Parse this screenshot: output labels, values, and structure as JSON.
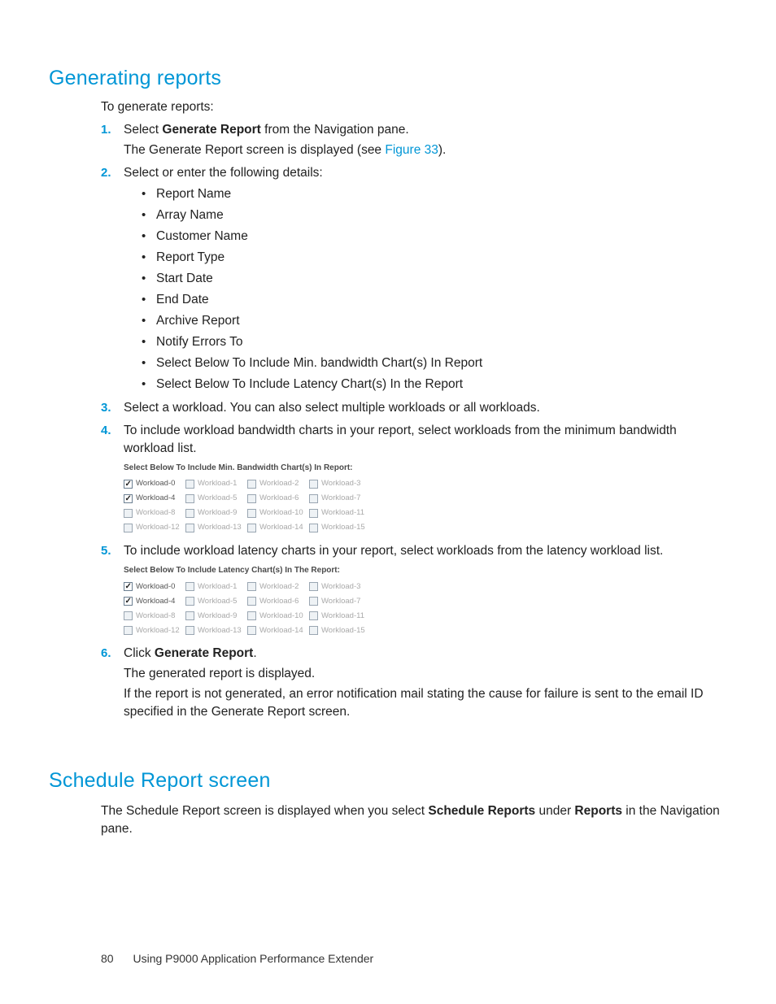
{
  "section1": {
    "title": "Generating reports",
    "intro": "To generate reports:",
    "steps": [
      {
        "num": "1.",
        "lines": [
          [
            {
              "t": "Select "
            },
            {
              "t": "Generate Report",
              "b": true
            },
            {
              "t": " from the Navigation pane."
            }
          ],
          [
            {
              "t": "The Generate Report screen is displayed (see "
            },
            {
              "t": "Figure 33",
              "link": true
            },
            {
              "t": ")."
            }
          ]
        ]
      },
      {
        "num": "2.",
        "lines": [
          [
            {
              "t": "Select or enter the following details:"
            }
          ]
        ],
        "bullets": [
          "Report Name",
          "Array Name",
          "Customer Name",
          "Report Type",
          "Start Date",
          "End Date",
          "Archive Report",
          "Notify Errors To",
          "Select Below To Include Min. bandwidth Chart(s) In Report",
          "Select Below To Include Latency Chart(s) In the Report"
        ]
      },
      {
        "num": "3.",
        "lines": [
          [
            {
              "t": "Select a workload. You can also select multiple workloads or all workloads."
            }
          ]
        ]
      },
      {
        "num": "4.",
        "lines": [
          [
            {
              "t": "To include workload bandwidth charts in your report, select workloads from the minimum bandwidth workload list."
            }
          ]
        ],
        "panel": "bw"
      },
      {
        "num": "5.",
        "lines": [
          [
            {
              "t": "To include workload latency charts in your report, select workloads from the latency workload list."
            }
          ]
        ],
        "panel": "lat"
      },
      {
        "num": "6.",
        "lines": [
          [
            {
              "t": "Click "
            },
            {
              "t": "Generate Report",
              "b": true
            },
            {
              "t": "."
            }
          ],
          [
            {
              "t": "The generated report is displayed."
            }
          ],
          [
            {
              "t": "If the report is not generated, an error notification mail stating the cause for failure is sent to the email ID specified in the Generate Report screen."
            }
          ]
        ]
      }
    ]
  },
  "panels": {
    "bw": {
      "title": "Select Below To Include Min. Bandwidth Chart(s) In Report:",
      "rows": [
        [
          {
            "label": "Workload-0",
            "checked": true,
            "active": true
          },
          {
            "label": "Workload-1"
          },
          {
            "label": "Workload-2"
          },
          {
            "label": "Workload-3"
          }
        ],
        [
          {
            "label": "Workload-4",
            "checked": true,
            "active": true
          },
          {
            "label": "Workload-5"
          },
          {
            "label": "Workload-6"
          },
          {
            "label": "Workload-7"
          }
        ],
        [
          {
            "label": "Workload-8"
          },
          {
            "label": "Workload-9"
          },
          {
            "label": "Workload-10"
          },
          {
            "label": "Workload-11"
          }
        ],
        [
          {
            "label": "Workload-12"
          },
          {
            "label": "Workload-13"
          },
          {
            "label": "Workload-14"
          },
          {
            "label": "Workload-15"
          }
        ]
      ]
    },
    "lat": {
      "title": "Select Below To Include Latency Chart(s) In The Report:",
      "rows": [
        [
          {
            "label": "Workload-0",
            "checked": true,
            "active": true
          },
          {
            "label": "Workload-1"
          },
          {
            "label": "Workload-2"
          },
          {
            "label": "Workload-3"
          }
        ],
        [
          {
            "label": "Workload-4",
            "checked": true,
            "active": true
          },
          {
            "label": "Workload-5"
          },
          {
            "label": "Workload-6"
          },
          {
            "label": "Workload-7"
          }
        ],
        [
          {
            "label": "Workload-8"
          },
          {
            "label": "Workload-9"
          },
          {
            "label": "Workload-10"
          },
          {
            "label": "Workload-11"
          }
        ],
        [
          {
            "label": "Workload-12"
          },
          {
            "label": "Workload-13"
          },
          {
            "label": "Workload-14"
          },
          {
            "label": "Workload-15"
          }
        ]
      ]
    }
  },
  "section2": {
    "title": "Schedule Report screen",
    "para": [
      {
        "t": "The Schedule Report screen is displayed when you select "
      },
      {
        "t": "Schedule Reports",
        "b": true
      },
      {
        "t": " under "
      },
      {
        "t": "Reports",
        "b": true
      },
      {
        "t": " in the Navigation pane."
      }
    ]
  },
  "footer": {
    "page": "80",
    "title": "Using P9000 Application Performance Extender"
  }
}
